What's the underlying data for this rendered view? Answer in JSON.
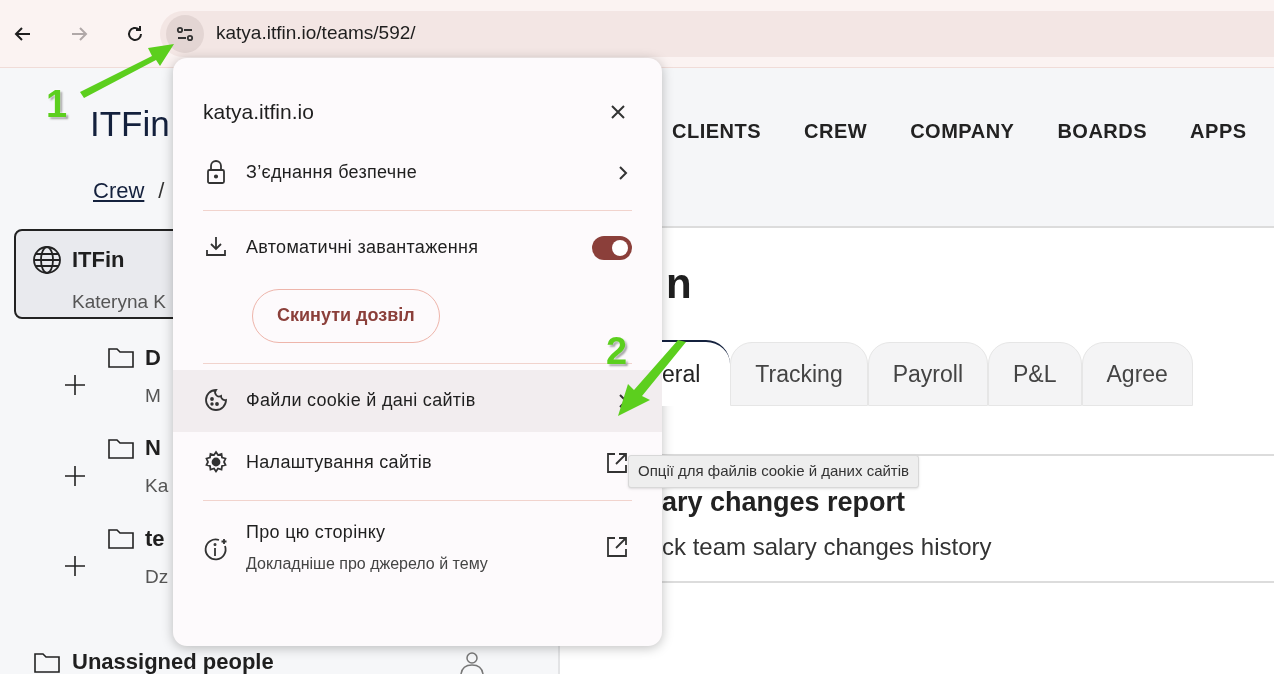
{
  "browser": {
    "back_disabled": false,
    "forward_disabled": true,
    "url": "katya.itfin.io/teams/592/"
  },
  "app": {
    "logo": "ITFin",
    "breadcrumb": [
      "Crew",
      "/"
    ],
    "team_card": {
      "title": "ITFin",
      "subtitle": "Kateryna K",
      "selected": true
    },
    "folders": [
      {
        "name": "D",
        "subtitle": "M"
      },
      {
        "name": "N",
        "subtitle": "Ka"
      },
      {
        "name": "te",
        "subtitle": "Dz"
      }
    ],
    "unassigned": "Unassigned people",
    "nav": [
      "CLIENTS",
      "CREW",
      "COMPANY",
      "BOARDS",
      "APPS"
    ],
    "heading": "n",
    "tabs": [
      {
        "label": "eral",
        "selected": true
      },
      {
        "label": "Tracking",
        "selected": false
      },
      {
        "label": "Payroll",
        "selected": false
      },
      {
        "label": "P&L",
        "selected": false
      },
      {
        "label": "Agree",
        "selected": false
      }
    ],
    "report": {
      "title": "ary changes report",
      "description": "ck team salary changes history"
    }
  },
  "site_info_popup": {
    "domain": "katya.itfin.io",
    "items": [
      {
        "kind": "submenu",
        "label": "З’єднання безпечне",
        "hovered": false
      },
      {
        "kind": "toggle",
        "label": "Автоматичні завантаження",
        "on": true,
        "button": "Скинути дозвіл"
      },
      {
        "kind": "submenu",
        "label": "Файли cookie й дані сайтів",
        "hovered": true
      },
      {
        "kind": "external",
        "label": "Налаштування сайтів"
      },
      {
        "kind": "external",
        "label": "Про цю сторінку",
        "description": "Докладніше про джерело й тему"
      }
    ]
  },
  "tooltip": "Опції для файлів cookie й даних сайтів",
  "annotations": [
    {
      "label": "1"
    },
    {
      "label": "2"
    }
  ]
}
